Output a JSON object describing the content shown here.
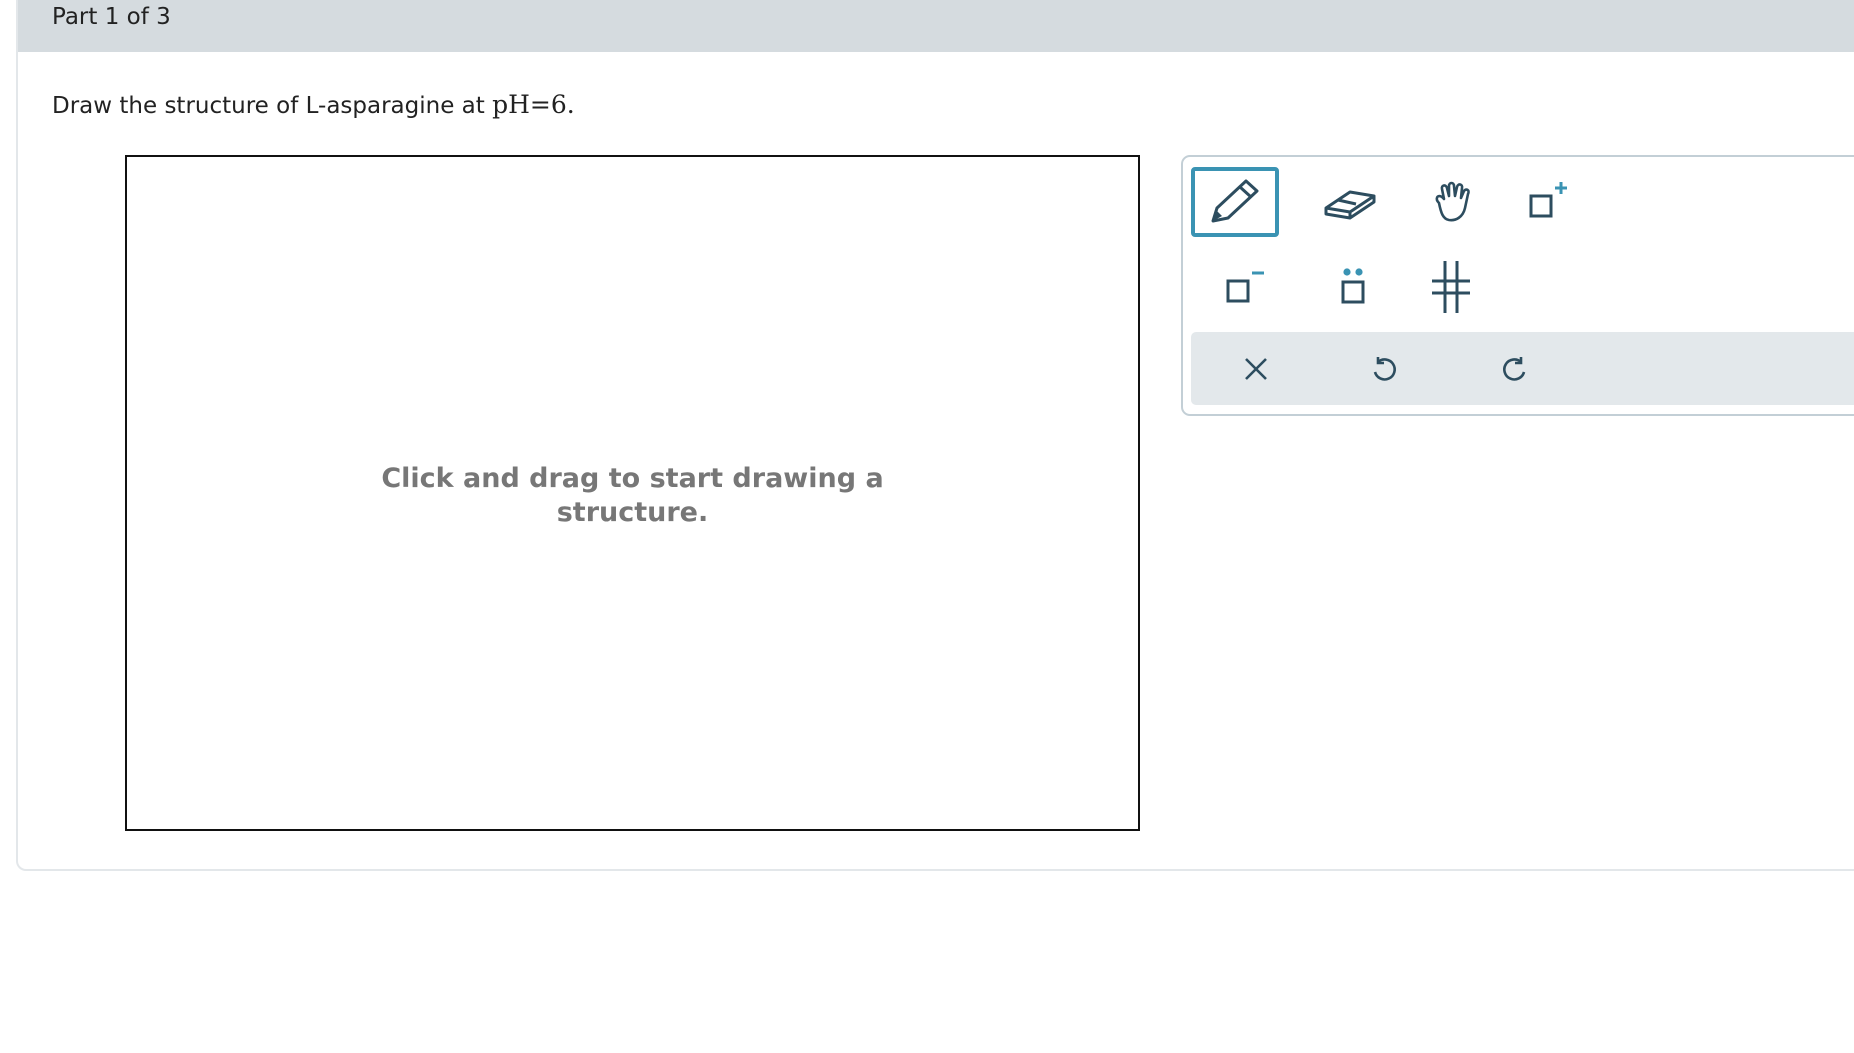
{
  "part_header": {
    "label": "Part 1 of 3"
  },
  "question": {
    "text_before": "Draw the structure of L-asparagine at ",
    "math": "pH=6",
    "text_after": "."
  },
  "canvas": {
    "hint_line1": "Click and drag to start drawing a",
    "hint_line2": "structure."
  },
  "toolbox": {
    "selected_tool": "pencil",
    "tools": [
      "pencil-icon",
      "eraser-icon",
      "hand-icon",
      "add-positive-charge-icon",
      "add-negative-charge-icon",
      "add-lone-pair-icon",
      "stereo-bond-icon"
    ],
    "actions": [
      "clear-icon",
      "undo-icon",
      "redo-icon"
    ]
  },
  "colors": {
    "header_bg": "#d5dbdf",
    "accent": "#3a93b3",
    "icon": "#2d4d5f",
    "hint_text": "#777777"
  }
}
